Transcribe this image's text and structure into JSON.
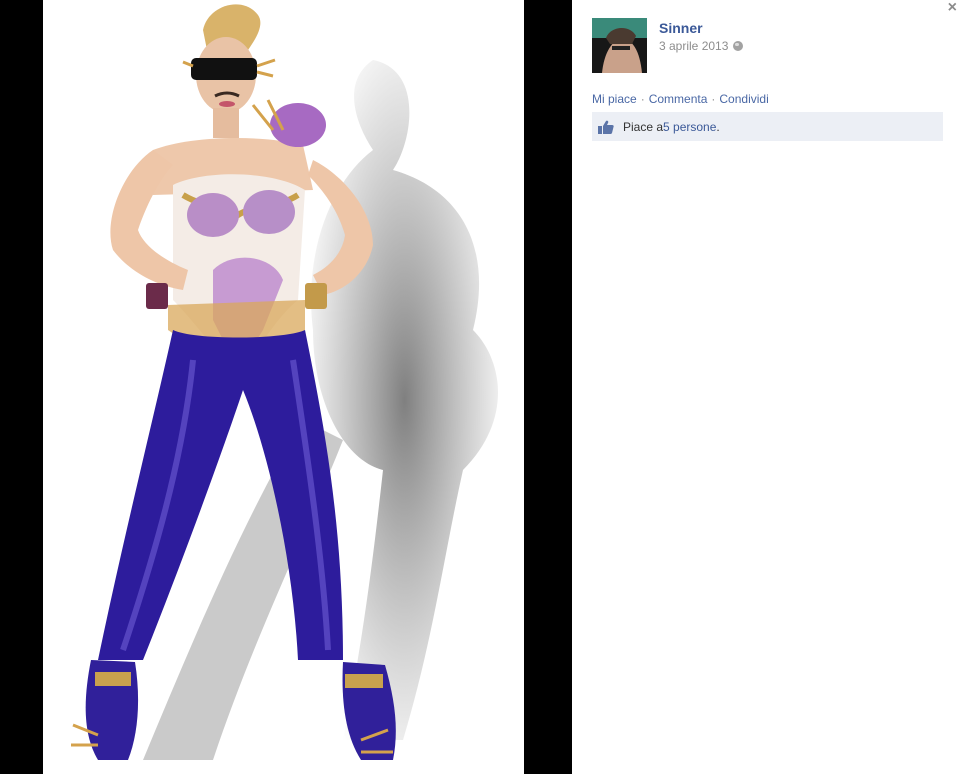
{
  "post": {
    "author_name": "Sinner",
    "date": "3 aprile 2013",
    "audience_icon": "globe-icon"
  },
  "actions": {
    "like": "Mi piace",
    "comment": "Commenta",
    "share": "Condividi"
  },
  "likes": {
    "prefix": "Piace a ",
    "count_link": "5 persone",
    "suffix": "."
  },
  "viewer": {
    "close_label": "×",
    "photo_subject": "fashion-model-photo"
  }
}
